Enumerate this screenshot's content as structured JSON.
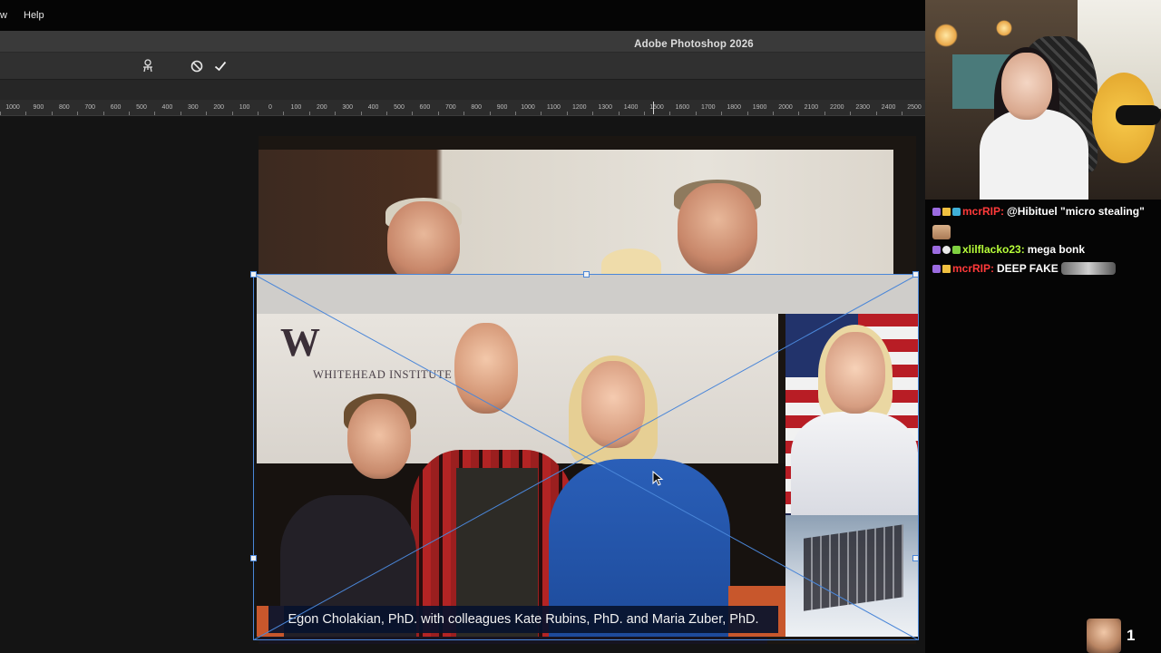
{
  "menu": {
    "view_fragment": "w",
    "help": "Help"
  },
  "app": {
    "title": "Adobe Photoshop 2026"
  },
  "options_bar": {
    "icons": [
      "puppet-warp-icon",
      "cancel-transform-icon",
      "commit-transform-icon"
    ]
  },
  "ruler": {
    "labels": [
      "1000",
      "900",
      "800",
      "700",
      "600",
      "500",
      "400",
      "300",
      "200",
      "100",
      "0",
      "100",
      "200",
      "300",
      "400",
      "500",
      "600",
      "700",
      "800",
      "900",
      "1000",
      "1100",
      "1200",
      "1300",
      "1400",
      "1500",
      "1600",
      "1700",
      "1800",
      "1900",
      "2000",
      "2100",
      "2200",
      "2300",
      "2400",
      "2500"
    ]
  },
  "document": {
    "logo_mark": "W",
    "institute_name": "WHITEHEAD INSTITUTE",
    "caption": "Egon Cholakian, PhD. with colleagues Kate Rubins, PhD. and Maria Zuber, PhD."
  },
  "colors": {
    "transform_box": "#4a86d8",
    "chat_user_mcrrip": "#ff3a3a",
    "chat_user_xlilflacko": "#b8ff3a"
  },
  "chat": {
    "messages": [
      {
        "user": "mcrRIP:",
        "text": "@Hibituel \"micro stealing\""
      },
      {
        "user": "xlilflacko23:",
        "text": "mega bonk"
      },
      {
        "user": "mcrRIP:",
        "text": "DEEP FAKE"
      }
    ]
  },
  "viewer": {
    "count": "1"
  }
}
